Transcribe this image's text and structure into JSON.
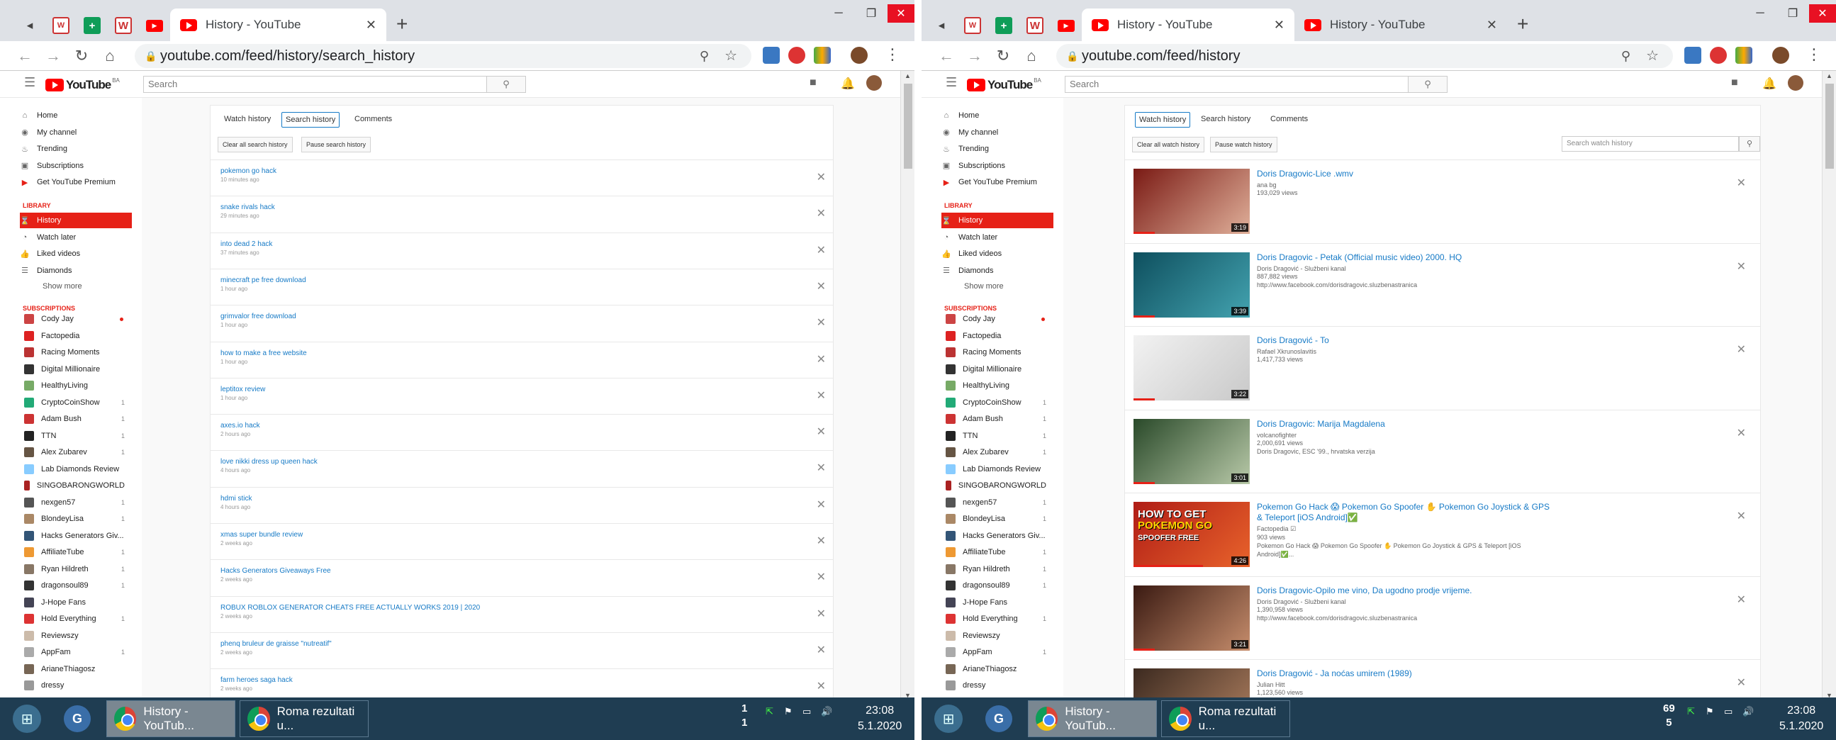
{
  "left": {
    "tab_title": "History - YouTube",
    "url": "youtube.com/feed/history/search_history",
    "search_placeholder": "Search",
    "tabs": [
      "Watch history",
      "Search history",
      "Comments"
    ],
    "buttons": [
      "Clear all search history",
      "Pause search history"
    ],
    "searches": [
      {
        "q": "pokemon go hack",
        "t": "10 minutes ago"
      },
      {
        "q": "snake rivals hack",
        "t": "29 minutes ago"
      },
      {
        "q": "into dead 2 hack",
        "t": "37 minutes ago"
      },
      {
        "q": "minecraft pe free download",
        "t": "1 hour ago"
      },
      {
        "q": "grimvalor free download",
        "t": "1 hour ago"
      },
      {
        "q": "how to make a free website",
        "t": "1 hour ago"
      },
      {
        "q": "leptitox review",
        "t": "1 hour ago"
      },
      {
        "q": "axes.io hack",
        "t": "2 hours ago"
      },
      {
        "q": "love nikki dress up queen hack",
        "t": "4 hours ago"
      },
      {
        "q": "hdmi stick",
        "t": "4 hours ago"
      },
      {
        "q": "xmas super bundle review",
        "t": "2 weeks ago"
      },
      {
        "q": "Hacks Generators Giveaways Free",
        "t": "2 weeks ago"
      },
      {
        "q": "ROBUX ROBLOX GENERATOR CHEATS FREE ACTUALLY WORKS 2019 | 2020",
        "t": "2 weeks ago"
      },
      {
        "q": "phenq bruleur de graisse \"nutreatif\"",
        "t": "2 weeks ago"
      },
      {
        "q": "farm heroes saga hack",
        "t": "2 weeks ago"
      }
    ],
    "taskbar": {
      "task1": "History - YouTub...",
      "task2": "Roma rezultati u...",
      "notif_top": "1",
      "notif_bottom": "1",
      "time": "23:08",
      "date": "5.1.2020"
    }
  },
  "right": {
    "tab_title": "History - YouTube",
    "tab2_title": "History - YouTube",
    "url": "youtube.com/feed/history",
    "search_placeholder": "Search",
    "tabs": [
      "Watch history",
      "Search history",
      "Comments"
    ],
    "buttons": [
      "Clear all watch history",
      "Pause watch history"
    ],
    "search_watch_placeholder": "Search watch history",
    "videos": [
      {
        "title": "Doris Dragovic-Lice .wmv",
        "channel": "ana bg",
        "views": "193,029 views",
        "desc": "",
        "dur": "3:19",
        "c1": "#7a1a14",
        "c2": "#e0b09a"
      },
      {
        "title": "Doris Dragovic - Petak (Official music video) 2000. HQ",
        "channel": "Doris Dragović - Službeni kanal",
        "views": "887,882 views",
        "desc": "http://www.facebook.com/dorisdragovic.sluzbenastranica",
        "dur": "3:39",
        "c1": "#0e4f5e",
        "c2": "#43a3b0"
      },
      {
        "title": "Doris Dragović - To",
        "channel": "Rafael Xkrunoslavitis",
        "views": "1,417,733 views",
        "desc": "",
        "dur": "3:22",
        "c1": "#f2f2f2",
        "c2": "#c9c9c9"
      },
      {
        "title": "Doris Dragovic: Marija Magdalena",
        "channel": "volcanofighter",
        "views": "2,000,691 views",
        "desc": "Doris Dragovic, ESC '99., hrvatska verzija",
        "dur": "3:01",
        "c1": "#2a4a2a",
        "c2": "#b8c9a8"
      },
      {
        "title": "Pokemon Go Hack 😱 Pokemon Go Spoofer ✋ Pokemon Go Joystick & GPS & Teleport [iOS Android]✅",
        "channel": "Factopedia ☑",
        "views": "903 views",
        "desc": "Pokemon Go Hack 😱 Pokemon Go Spoofer ✋ Pokemon Go Joystick & GPS & Teleport [iOS Android]✅...",
        "dur": "4:26",
        "c1": "#b01d16",
        "c2": "#e8632b"
      },
      {
        "title": "Doris Dragovic-Opilo me vino, Da ugodno prodje vrijeme.",
        "channel": "Doris Dragović - Službeni kanal",
        "views": "1,390,958 views",
        "desc": "http://www.facebook.com/dorisdragovic.sluzbenastranica",
        "dur": "3:21",
        "c1": "#3a1a12",
        "c2": "#c68d6c"
      },
      {
        "title": "Doris Dragović - Ja noćas umirem (1989)",
        "channel": "Julian Hitt",
        "views": "1,123,560 views",
        "desc": "",
        "dur": "",
        "c1": "#3c2a20",
        "c2": "#b08060"
      }
    ],
    "taskbar": {
      "task1": "History - YouTub...",
      "task2": "Roma rezultati u...",
      "notif_top": "69",
      "notif_bottom": "5",
      "time": "23:08",
      "date": "5.1.2020"
    }
  },
  "guide": {
    "main": [
      "Home",
      "My channel",
      "Trending",
      "Subscriptions",
      "Get YouTube Premium"
    ],
    "library_label": "LIBRARY",
    "library": [
      "History",
      "Watch later",
      "Liked videos",
      "Diamonds"
    ],
    "show_more": "Show more",
    "subs_label": "SUBSCRIPTIONS",
    "subs": [
      {
        "n": "Cody Jay",
        "c": "",
        "dot": true,
        "col": "#c44"
      },
      {
        "n": "Factopedia",
        "c": "",
        "col": "#d22"
      },
      {
        "n": "Racing Moments",
        "c": "",
        "col": "#b33"
      },
      {
        "n": "Digital Millionaire",
        "c": "",
        "col": "#333"
      },
      {
        "n": "HealthyLiving",
        "c": "",
        "col": "#7a6"
      },
      {
        "n": "CryptoCoinShow",
        "c": "1",
        "col": "#2a7"
      },
      {
        "n": "Adam Bush",
        "c": "1",
        "col": "#c33"
      },
      {
        "n": "TTN",
        "c": "1",
        "col": "#222"
      },
      {
        "n": "Alex Zubarev",
        "c": "1",
        "col": "#654"
      },
      {
        "n": "Lab Diamonds Review",
        "c": "",
        "col": "#8cf"
      },
      {
        "n": "SINGOBARONGWORLD",
        "c": "",
        "col": "#a22"
      },
      {
        "n": "nexgen57",
        "c": "1",
        "col": "#555"
      },
      {
        "n": "BlondeyLisa",
        "c": "1",
        "col": "#a86"
      },
      {
        "n": "Hacks Generators Giv...",
        "c": "",
        "col": "#357"
      },
      {
        "n": "AffiliateTube",
        "c": "1",
        "col": "#e93"
      },
      {
        "n": "Ryan Hildreth",
        "c": "1",
        "col": "#876"
      },
      {
        "n": "dragonsoul89",
        "c": "1",
        "col": "#333"
      },
      {
        "n": "J-Hope Fans",
        "c": "",
        "col": "#445"
      },
      {
        "n": "Hold Everything",
        "c": "1",
        "col": "#d33"
      },
      {
        "n": "Reviewszy",
        "c": "",
        "col": "#cba"
      },
      {
        "n": "AppFam",
        "c": "1",
        "col": "#aaa"
      },
      {
        "n": "ArianeThiagosz",
        "c": "",
        "col": "#765"
      },
      {
        "n": "dressy",
        "c": "",
        "col": "#999"
      }
    ]
  }
}
